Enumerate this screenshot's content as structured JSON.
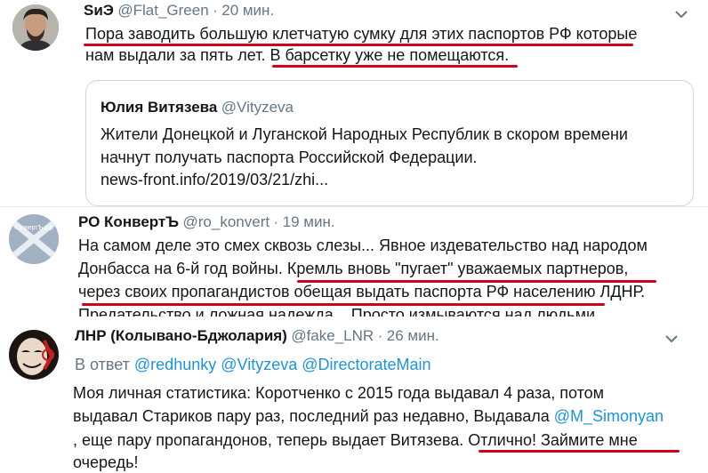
{
  "tweet1": {
    "name": "SиЭ",
    "handle": "@Flat_Green",
    "time": "20 мин.",
    "lines": [
      "Пора заводить большую клетчатую сумку для этих паспортов РФ которые",
      "нам выдали за пять лет. В барсетку уже не помещаются."
    ],
    "quote": {
      "name": "Юлия Витязева",
      "handle": "@Vityzeva",
      "lines": [
        "Жители Донецкой и Луганской Народных Республик в скором времени",
        "начнут получать паспорта Российской Федерации.",
        "news-front.info/2019/03/21/zhi..."
      ]
    }
  },
  "tweet2": {
    "name": "РО КонвертЪ",
    "handle": "@ro_konvert",
    "time": "19 мин.",
    "avatar_text": "КонвертЪ.рф",
    "lines": [
      "На самом деле это смех сквозь слезы... Явное издевательство над народом",
      "Донбасса на 6-й год войны. Кремль вновь \"пугает\" уважаемых партнеров,",
      "через своих пропагандистов обещая выдать паспорта РФ населению ЛДНР.",
      "Предательство и ложная надежда... Просто измываются над людьми..."
    ]
  },
  "tweet3": {
    "name": "ЛНР (Колывано-Бджолария)",
    "handle": "@fake_LNR",
    "time": "26 мин.",
    "reply_prefix": "В ответ",
    "reply_to": [
      "@redhunky",
      "@Vityzeva",
      "@DirectorateMain"
    ],
    "line1": "Моя личная статистика: Коротченко с 2015 года выдавал 4 раза, потом",
    "line2_pre": "выдавал Стариков пару раз, последний раз недавно, Выдавала ",
    "line2_mention": "@M_Simonyan",
    "line3": ", еще пару пропагандонов, теперь выдает Витязева. Отлично! Займите мне",
    "line4": "очередь!"
  },
  "colors": {
    "link": "#1b95e0",
    "underline": "#d0021b",
    "secondary": "#657786"
  },
  "icons": [
    "chevron-down-icon",
    "avatar"
  ]
}
